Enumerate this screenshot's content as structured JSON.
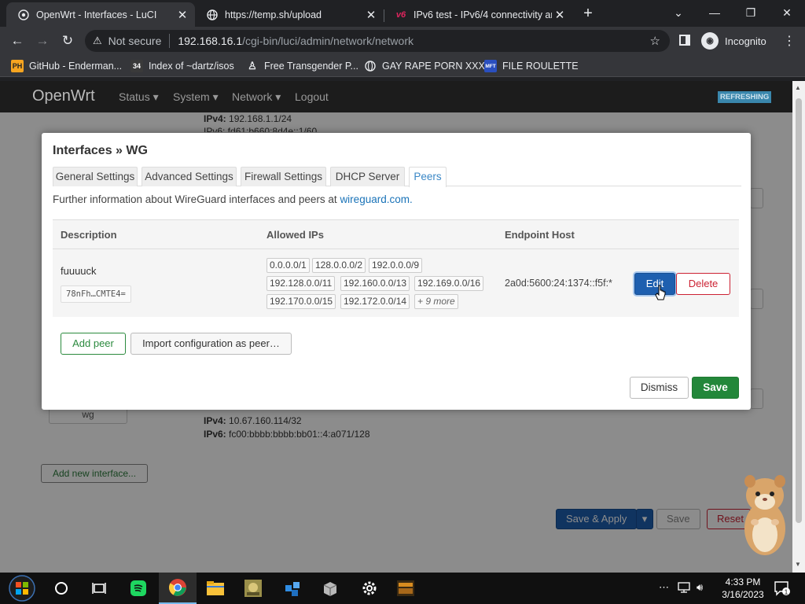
{
  "browser": {
    "tabs": [
      {
        "title": "OpenWrt - Interfaces - LuCI",
        "icon": "globe-icon",
        "active": true
      },
      {
        "title": "https://temp.sh/upload",
        "icon": "globe-icon",
        "active": false
      },
      {
        "title": "IPv6 test - IPv6/4 connectivity an",
        "icon": "v6-icon",
        "active": false
      }
    ],
    "address": {
      "security": "Not secure",
      "host": "192.168.16.1",
      "path": "/cgi-bin/luci/admin/network/network"
    },
    "profile": "Incognito",
    "bookmarks": [
      {
        "label": "GitHub - Enderman...",
        "icon": "PH",
        "color": "#f7a520"
      },
      {
        "label": "Index of ~dartz/isos",
        "icon": "34",
        "color": "#3a3a3a"
      },
      {
        "label": "Free Transgender P...",
        "icon": "T",
        "color": "#3a3a3a"
      },
      {
        "label": "GAY RAPE PORN XXX",
        "icon": "G",
        "color": "#5f6368"
      },
      {
        "label": "FILE ROULETTE",
        "icon": "MFT",
        "color": "#2a4fbf"
      }
    ]
  },
  "luci": {
    "brand": "OpenWrt",
    "menu": [
      "Status",
      "System",
      "Network",
      "Logout"
    ],
    "status_badge": "REFRESHING",
    "background": {
      "lan_ipv4_label": "IPv4:",
      "lan_ipv4": "192.168.1.1/24",
      "lan_ipv6_partial": "IPv6: fd61:b660:8d4e::1/60",
      "wg_iface_label": "wg",
      "wg_ipv4_label": "IPv4:",
      "wg_ipv4": "10.67.160.114/32",
      "wg_ipv6_label": "IPv6:",
      "wg_ipv6": "fc00:bbbb:bbbb:bb01::4:a071/128",
      "add_new_interface": "Add new interface...",
      "save_apply": "Save & Apply",
      "save": "Save",
      "reset": "Reset"
    }
  },
  "modal": {
    "title": "Interfaces » WG",
    "tabs": [
      "General Settings",
      "Advanced Settings",
      "Firewall Settings",
      "DHCP Server",
      "Peers"
    ],
    "active_tab": "Peers",
    "info_text": "Further information about WireGuard interfaces and peers at ",
    "info_link": "wireguard.com",
    "info_suffix": ".",
    "table": {
      "headers": [
        "Description",
        "Allowed IPs",
        "Endpoint Host"
      ],
      "peer": {
        "description": "fuuuuck",
        "public_key": "78nFh…CMTE4=",
        "allowed_ips": [
          "0.0.0.0/1",
          "128.0.0.0/2",
          "192.0.0.0/9",
          "192.128.0.0/11",
          "192.160.0.0/13",
          "192.169.0.0/16",
          "192.170.0.0/15",
          "192.172.0.0/14"
        ],
        "more": "+ 9 more",
        "endpoint": "2a0d:5600:24:1374::f5f:*",
        "edit_label": "Edit",
        "delete_label": "Delete"
      }
    },
    "add_peer": "Add peer",
    "import_peer": "Import configuration as peer…",
    "dismiss": "Dismiss",
    "save": "Save"
  },
  "taskbar": {
    "time": "4:33 PM",
    "date": "3/16/2023",
    "notification_count": "1"
  },
  "colors": {
    "edit_button": "#1e5faf",
    "delete_button": "#cc2233",
    "save_button": "#23873a",
    "link": "#1a73b8"
  }
}
